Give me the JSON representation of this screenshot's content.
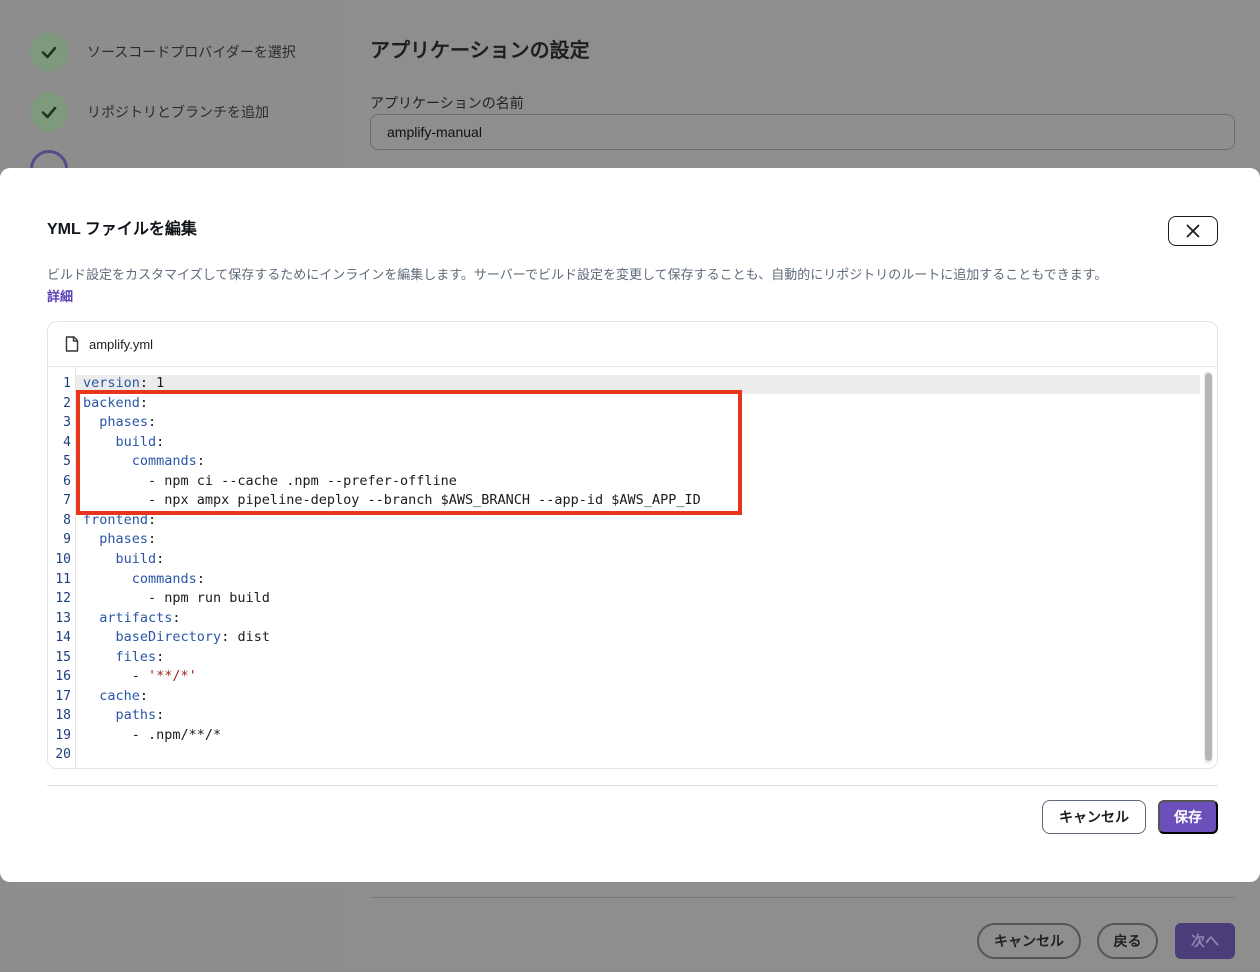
{
  "background": {
    "steps": [
      {
        "label": "ソースコードプロバイダーを選択",
        "state": "done"
      },
      {
        "label": "リポジトリとブランチを追加",
        "state": "done"
      }
    ],
    "title": "アプリケーションの設定",
    "field_label": "アプリケーションの名前",
    "field_value": "amplify-manual",
    "buttons": {
      "cancel": "キャンセル",
      "back": "戻る",
      "next": "次へ"
    }
  },
  "modal": {
    "title": "YML ファイルを編集",
    "close_icon": "close-icon",
    "description": "ビルド設定をカスタマイズして保存するためにインラインを編集します。サーバーでビルド設定を変更して保存することも、自動的にリポジトリのルートに追加することもできます。",
    "link": "詳細",
    "editor": {
      "file_icon": "file-icon",
      "file_name": "amplify.yml",
      "lines": [
        "version: 1",
        "backend:",
        "  phases:",
        "    build:",
        "      commands:",
        "        - npm ci --cache .npm --prefer-offline",
        "        - npx ampx pipeline-deploy --branch $AWS_BRANCH --app-id $AWS_APP_ID",
        "frontend:",
        "  phases:",
        "    build:",
        "      commands:",
        "        - npm run build",
        "  artifacts:",
        "    baseDirectory: dist",
        "    files:",
        "      - '**/*'",
        "  cache:",
        "    paths:",
        "      - .npm/**/*",
        ""
      ],
      "highlight_lines": [
        2,
        7
      ]
    },
    "buttons": {
      "cancel": "キャンセル",
      "save": "保存"
    }
  },
  "colors": {
    "accent": "#6b4fbb",
    "highlight": "#e8361c",
    "yaml_key": "#2b56a6",
    "yaml_string": "#a0281e"
  }
}
